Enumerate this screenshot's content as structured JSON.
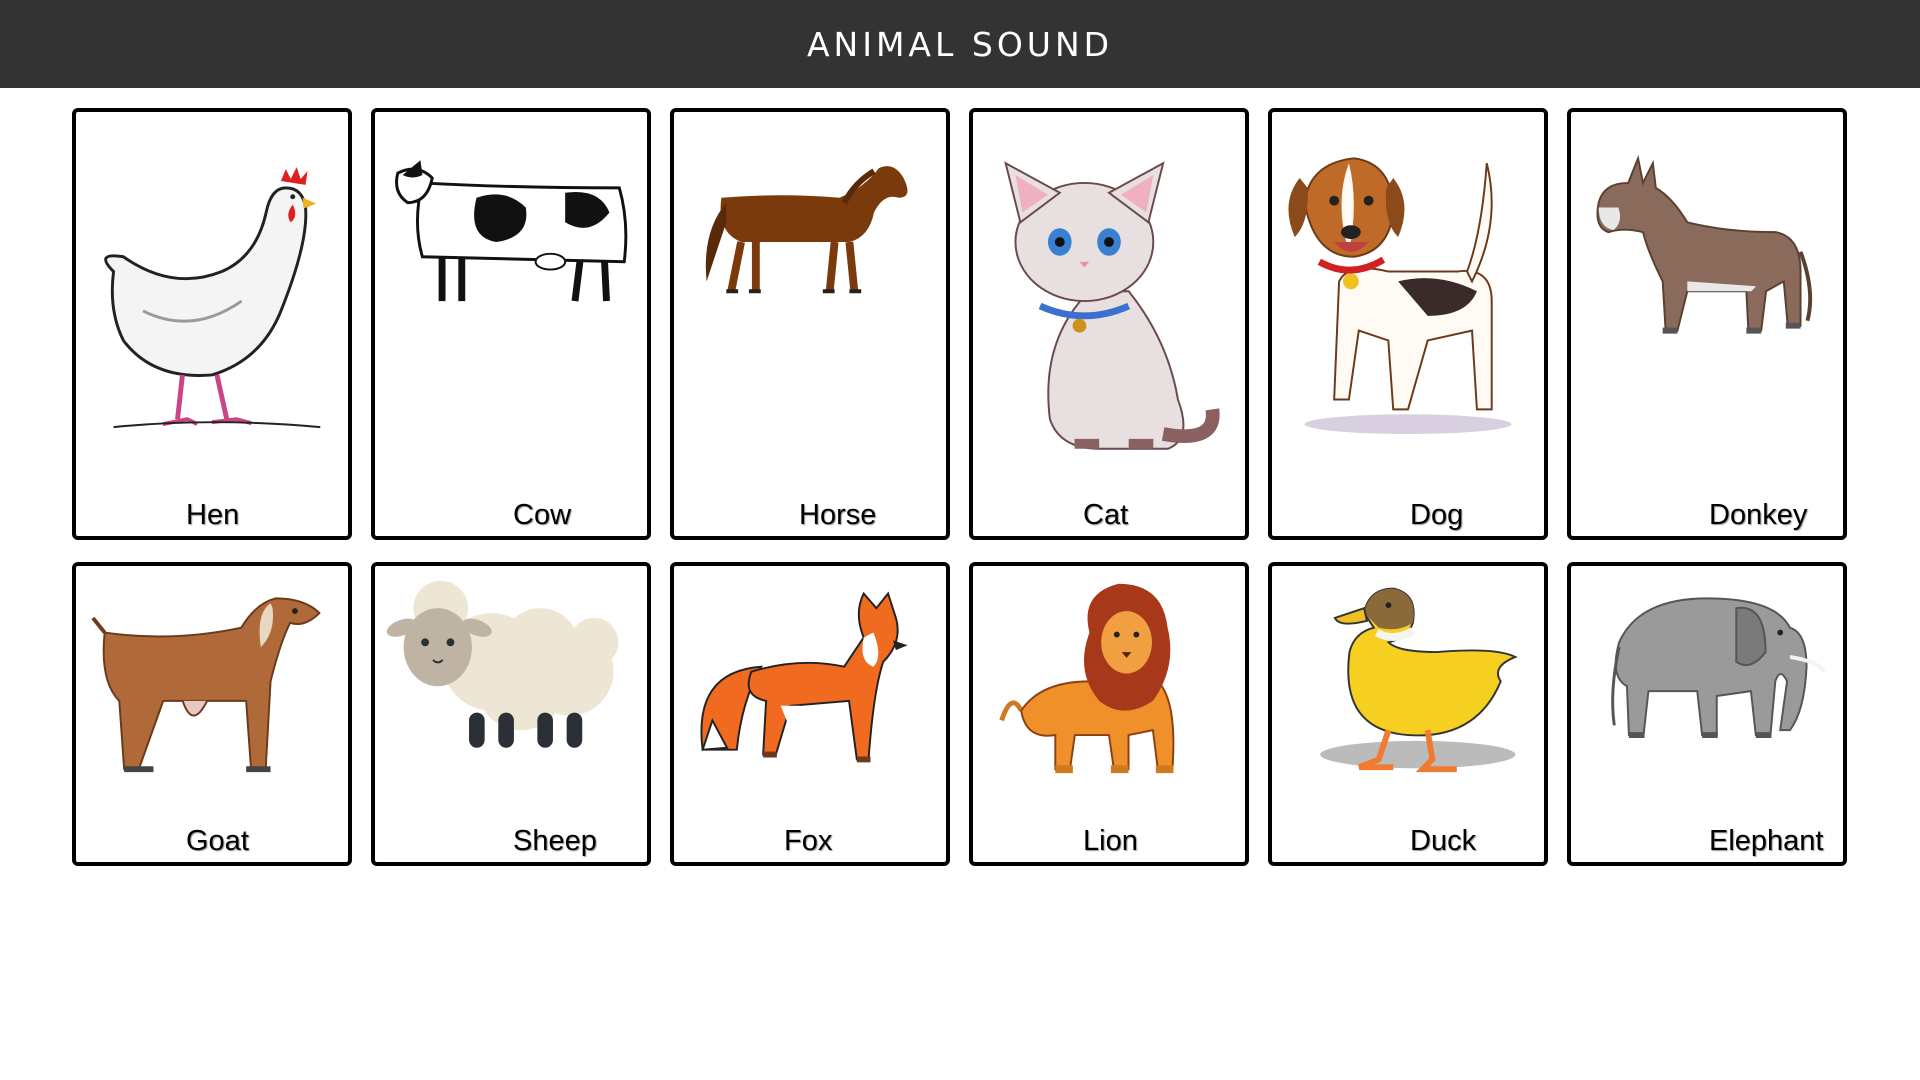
{
  "header": {
    "title": "ANIMAL SOUND"
  },
  "animals": [
    {
      "label": "Hen",
      "icon": "hen-image"
    },
    {
      "label": "Cow",
      "icon": "cow-image"
    },
    {
      "label": "Horse",
      "icon": "horse-image"
    },
    {
      "label": "Cat",
      "icon": "cat-image"
    },
    {
      "label": "Dog",
      "icon": "dog-image"
    },
    {
      "label": "Donkey",
      "icon": "donkey-image"
    },
    {
      "label": "Goat",
      "icon": "goat-image"
    },
    {
      "label": "Sheep",
      "icon": "sheep-image"
    },
    {
      "label": "Fox",
      "icon": "fox-image"
    },
    {
      "label": "Lion",
      "icon": "lion-image"
    },
    {
      "label": "Duck",
      "icon": "duck-image"
    },
    {
      "label": "Elephant",
      "icon": "elephant-image"
    }
  ],
  "colors": {
    "header_bg": "#333333",
    "card_border": "#000000",
    "page_bg": "#ffffff"
  }
}
